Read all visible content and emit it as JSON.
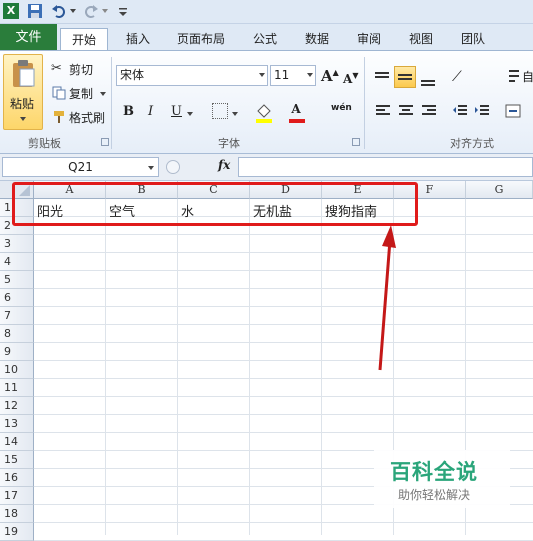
{
  "ribbon_tabs": [
    "文件",
    "开始",
    "插入",
    "页面布局",
    "公式",
    "数据",
    "审阅",
    "视图",
    "团队"
  ],
  "clipboard": {
    "paste": "粘贴",
    "cut": "剪切",
    "copy": "复制",
    "format_painter": "格式刷",
    "group": "剪贴板"
  },
  "font": {
    "name": "宋体",
    "size": "11",
    "group": "字体",
    "bold": "B",
    "italic": "I",
    "underline": "U",
    "grow": "A",
    "shrink": "A",
    "color": "A",
    "wen": "wén"
  },
  "alignment": {
    "group": "对齐方式",
    "wrap": "自"
  },
  "formula_bar": {
    "name_box": "Q21",
    "fx": "fx",
    "value": ""
  },
  "columns": [
    "A",
    "B",
    "C",
    "D",
    "E",
    "F",
    "G"
  ],
  "rows": [
    "1",
    "2",
    "3",
    "4",
    "5",
    "6",
    "7",
    "8",
    "9",
    "10",
    "11",
    "12",
    "13",
    "14",
    "15",
    "16",
    "17",
    "18",
    "19"
  ],
  "cells": {
    "A1": "阳光",
    "B1": "空气",
    "C1": "水",
    "D1": "无机盐",
    "E1": "搜狗指南"
  },
  "watermark": {
    "title": "百科全说",
    "subtitle": "助你轻松解决"
  },
  "colors": {
    "file_tab": "#2a7d3b",
    "highlight": "#e01b1b",
    "watermark_green": "#2aa57a"
  }
}
